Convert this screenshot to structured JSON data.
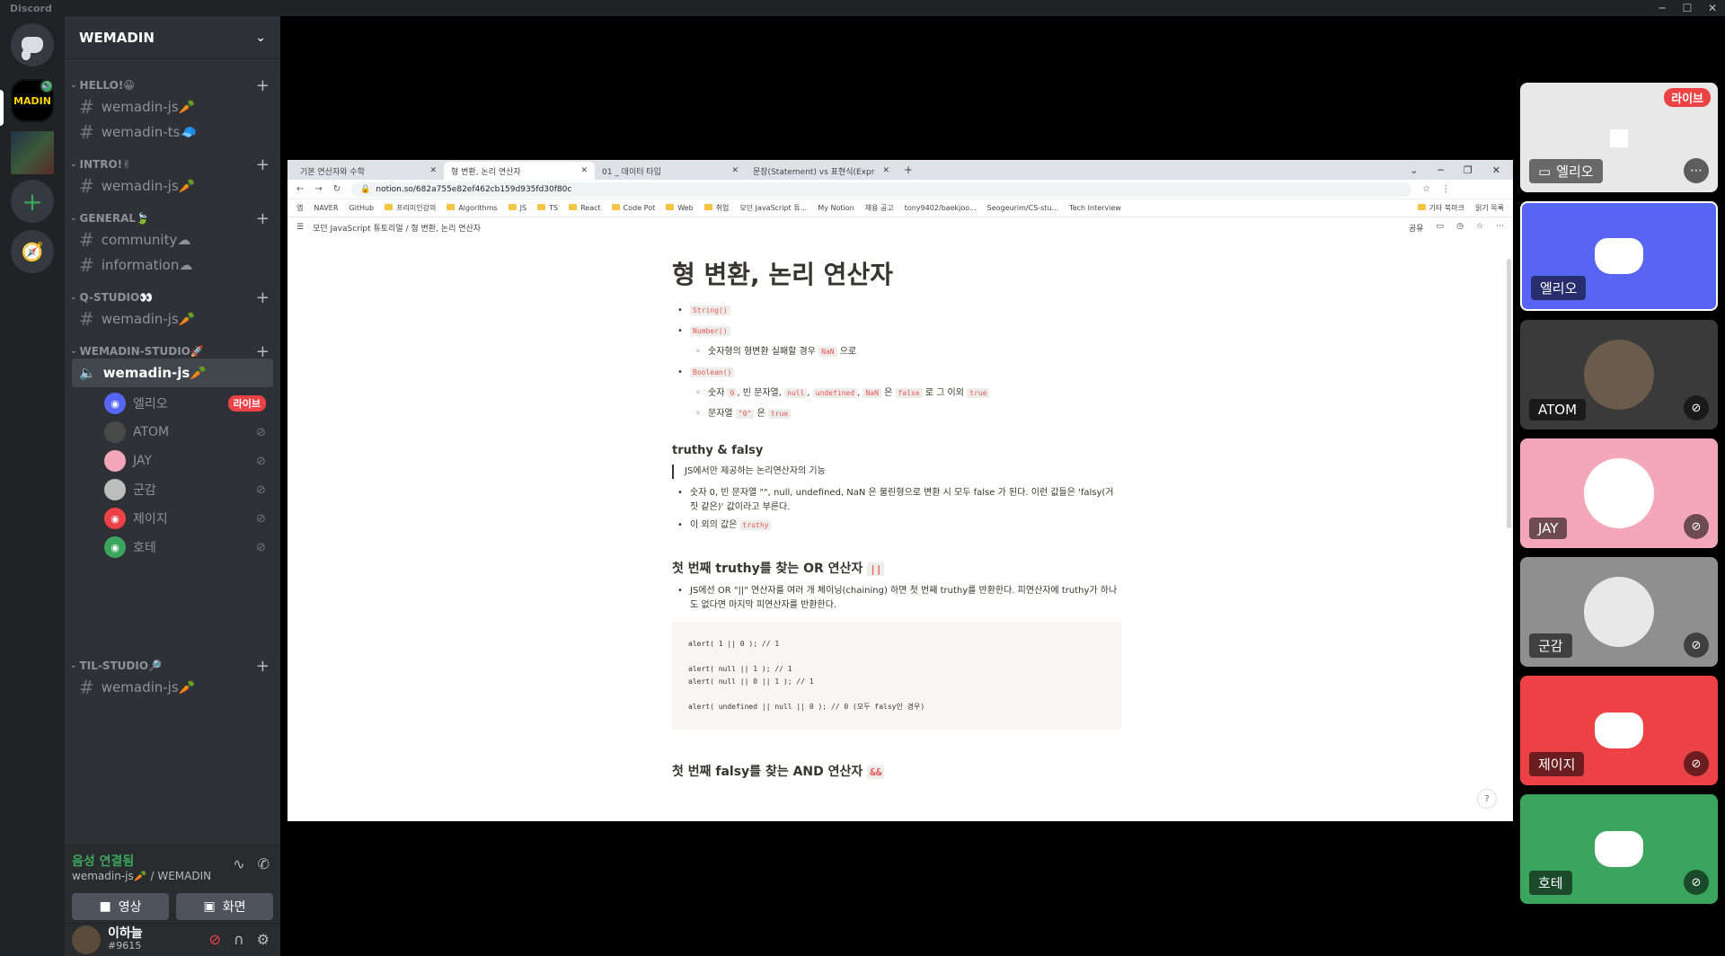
{
  "app": {
    "title": "Discord"
  },
  "server": {
    "name": "WEMADIN",
    "categories": [
      {
        "name": "HELLO!😀",
        "channels": [
          "wemadin-js🥕",
          "wemadin-ts🧢"
        ]
      },
      {
        "name": "INTRO!✌",
        "channels": [
          "wemadin-js🥕"
        ]
      },
      {
        "name": "GENERAL🍃",
        "channels": [
          "community☁",
          "information☁"
        ]
      },
      {
        "name": "Q-STUDIO👀",
        "channels": [
          "wemadin-js🥕"
        ]
      },
      {
        "name": "WEMADIN-STUDIO🚀",
        "channels": [
          "wemadin-js🥕"
        ]
      },
      {
        "name": "TIL-STUDIO🔎",
        "channels": [
          "wemadin-js🥕"
        ]
      }
    ],
    "voice_members": [
      {
        "name": "엘리오",
        "status": "라이브"
      },
      {
        "name": "ATOM"
      },
      {
        "name": "JAY"
      },
      {
        "name": "군감"
      },
      {
        "name": "제이지"
      },
      {
        "name": "호테"
      }
    ]
  },
  "voice_panel": {
    "status": "음성 연결됨",
    "channel": "wemadin-js🥕 / WEMADIN",
    "video_label": "영상",
    "screen_label": "화면"
  },
  "user": {
    "name": "이하늘",
    "tag": "#9615"
  },
  "browser": {
    "tabs": [
      "기본 연산자와 수학",
      "형 변환, 논리 연산자",
      "01 _ 데이터 타입",
      "문장(Statement) vs 표현식(Expr"
    ],
    "url": "notion.so/682a755e82ef462cb159d935fd30f80c",
    "bookmarks": [
      "앱",
      "NAVER",
      "GitHub",
      "프리미인강의",
      "Algorithms",
      "JS",
      "TS",
      "React",
      "Code Pot",
      "Web",
      "취업",
      "모던 JavaScript 튜...",
      "My Notion",
      "채용 공고",
      "tony9402/baekjoo...",
      "Seogeurim/CS-stu...",
      "Tech Interview",
      "기타 북마크",
      "읽기 목록"
    ],
    "breadcrumb": [
      "모던 JavaScript 튜토리얼",
      "형 변환, 논리 연산자"
    ],
    "page_actions": [
      "공유"
    ]
  },
  "notion": {
    "title": "형 변환, 논리 연산자",
    "list1": [
      "String()",
      "Number()"
    ],
    "number_sub_text": "숫자형의 형변환 실패할 경우",
    "number_sub_code": "NaN",
    "number_sub_after": "으로",
    "boolean_label": "Boolean()",
    "boolean_sub1_prefix": "숫자",
    "boolean_sub1_codes": [
      "0",
      "null",
      "undefined",
      "NaN"
    ],
    "boolean_sub1_mid": "빈 문자열,",
    "boolean_sub1_is": "은",
    "boolean_sub1_false": "false",
    "boolean_sub1_else": "로 그 이외",
    "boolean_sub1_true": "true",
    "boolean_sub2_prefix": "문자열",
    "boolean_sub2_code": "\"0\"",
    "boolean_sub2_is": "은",
    "boolean_sub2_true": "true",
    "truthy_heading": "truthy & falsy",
    "truthy_desc": "JS에서만 제공하는 논리연산자의 기능",
    "truthy_li1": "숫자 0, 빈 문자열 \"\", null, undefined, NaN 은 불린형으로 변환 시 모두 false 가 된다. 이런 값들은 'falsy(거짓 같은)' 값이라고 부른다.",
    "truthy_li2_prefix": "이 외의 값은",
    "truthy_li2_code": "truthy",
    "or_heading": "첫 번째 truthy를 찾는 OR 연산자",
    "or_heading_code": "||",
    "or_li": "JS에선 OR \"||\" 연산자를 여러 개 체이닝(chaining) 하면 첫 번째 truthy를 반환한다. 피연산자에 truthy가 하나도 없다면 마지막 피연산자를 반환한다.",
    "code_lines": [
      "alert( 1 || 0 ); // 1",
      "",
      "alert( null || 1 ); // 1",
      "alert( null || 0 || 1 ); // 1",
      "",
      "alert( undefined || null || 0 ); // 0 (모두 falsy인 경우)"
    ],
    "and_heading": "첫 번째 falsy를 찾는 AND 연산자",
    "and_heading_code": "&&"
  },
  "tiles": [
    {
      "name": "엘리오",
      "badge": "라이브",
      "type": "stream"
    },
    {
      "name": "엘리오",
      "type": "discord",
      "color": "#5865f2"
    },
    {
      "name": "ATOM",
      "type": "photo",
      "color": "#3a3a3a"
    },
    {
      "name": "JAY",
      "type": "photo",
      "color": "#f4a7b9"
    },
    {
      "name": "군감",
      "type": "photo",
      "color": "#8f8f8f"
    },
    {
      "name": "제이지",
      "type": "discord",
      "color": "#ed4245"
    },
    {
      "name": "호테",
      "type": "discord",
      "color": "#3ba55d"
    }
  ]
}
